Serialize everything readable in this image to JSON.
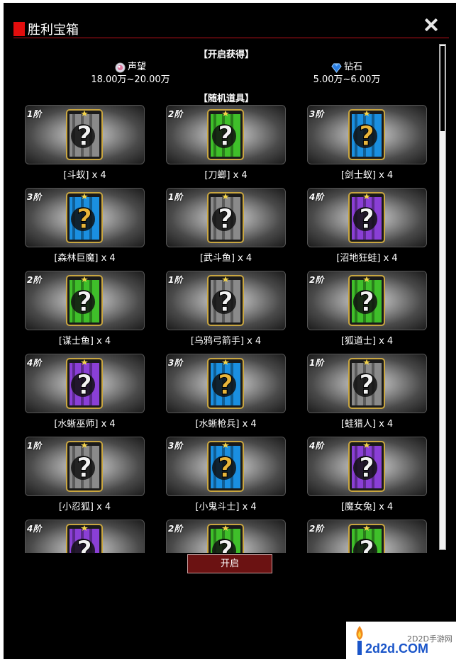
{
  "header": {
    "title": "胜利宝箱",
    "close_icon": "close-icon"
  },
  "rewards": {
    "section_title": "【开启获得】",
    "items": [
      {
        "name": "声望",
        "range": "18.00万~20.00万",
        "icon": "reputation-icon"
      },
      {
        "name": "钻石",
        "range": "5.00万~6.00万",
        "icon": "diamond-icon"
      }
    ]
  },
  "random_items": {
    "section_title": "【随机道具】",
    "cards": [
      {
        "tier": "1阶",
        "label": "[斗蚁] x 4",
        "color": "gray"
      },
      {
        "tier": "2阶",
        "label": "[刀螂] x 4",
        "color": "green"
      },
      {
        "tier": "3阶",
        "label": "[剑士蚁] x 4",
        "color": "blue"
      },
      {
        "tier": "3阶",
        "label": "[森林巨魔] x 4",
        "color": "blue"
      },
      {
        "tier": "1阶",
        "label": "[武斗鱼] x 4",
        "color": "gray"
      },
      {
        "tier": "4阶",
        "label": "[沼地狂蛙] x 4",
        "color": "purple"
      },
      {
        "tier": "2阶",
        "label": "[谋士鱼] x 4",
        "color": "green"
      },
      {
        "tier": "1阶",
        "label": "[乌鸦弓箭手] x 4",
        "color": "gray"
      },
      {
        "tier": "2阶",
        "label": "[狐道士] x 4",
        "color": "green"
      },
      {
        "tier": "4阶",
        "label": "[水蜥巫师] x 4",
        "color": "purple"
      },
      {
        "tier": "3阶",
        "label": "[水蜥枪兵] x 4",
        "color": "blue"
      },
      {
        "tier": "1阶",
        "label": "[蛙猎人] x 4",
        "color": "gray"
      },
      {
        "tier": "1阶",
        "label": "[小忍狐] x 4",
        "color": "gray"
      },
      {
        "tier": "3阶",
        "label": "[小鬼斗士] x 4",
        "color": "blue"
      },
      {
        "tier": "4阶",
        "label": "[魔女兔] x 4",
        "color": "purple"
      },
      {
        "tier": "4阶",
        "label": "",
        "color": "purple"
      },
      {
        "tier": "2阶",
        "label": "",
        "color": "green"
      },
      {
        "tier": "2阶",
        "label": "",
        "color": "green"
      }
    ]
  },
  "actions": {
    "open_label": "开启"
  },
  "watermark": {
    "site_cn": "2D2D手游网",
    "site_en": "2d2d.COM"
  },
  "colors": {
    "gray": "#8a8a8a",
    "green": "#3fbf2a",
    "blue": "#1a8fe0",
    "purple": "#8a3fd6",
    "accent_red": "#e30d0d",
    "button_bg": "#6b1212"
  }
}
